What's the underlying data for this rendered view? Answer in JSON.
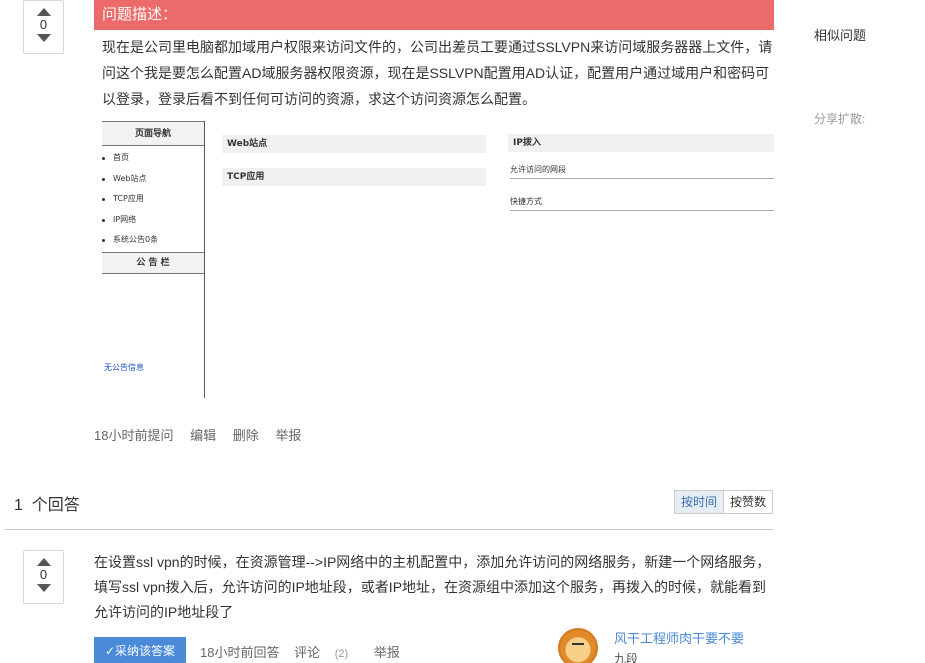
{
  "question": {
    "votes": "0",
    "header": "问题描述：",
    "body": "现在是公司里电脑都加域用户权限来访问文件的，公司出差员工要通过SSLVPN来访问域服务器器上文件，请问这个我是要怎么配置AD域服务器权限资源，现在是SSLVPN配置用AD认证，配置用户通过域用户和密码可以登录，登录后看不到任何可访问的资源，求这个访问资源怎么配置。",
    "meta": {
      "time": "18小时前提问",
      "edit": "编辑",
      "delete": "删除",
      "report": "举报"
    }
  },
  "screenshot": {
    "nav_title": "页面导航",
    "nav_items": [
      "首页",
      "Web站点",
      "TCP应用",
      "IP网络",
      "系统公告0条"
    ],
    "board_title": "公 告 栏",
    "notice": "无公告信息",
    "web_panel": "Web站点",
    "tcp_panel": "TCP应用",
    "ip_panel": "IP拨入",
    "allowed_segment": "允许访问的网段",
    "shortcut": "快捷方式"
  },
  "answers": {
    "count": "1",
    "count_label": "个回答",
    "sort": {
      "by_time": "按时间",
      "by_votes": "按赞数"
    }
  },
  "answer": {
    "votes": "0",
    "body": "在设置ssl vpn的时候，在资源管理-->IP网络中的主机配置中，添加允许访问的网络服务，新建一个网络服务，填写ssl vpn拨入后，允许访问的IP地址段，或者IP地址，在资源组中添加这个服务，再拨入的时候，就能看到允许访问的IP地址段了",
    "accept": "✓采纳该答案",
    "time": "18小时前回答",
    "comment": "评论",
    "comment_count": "(2)",
    "report": "举报",
    "username": "风干工程师肉干要不要",
    "rank": "九段"
  },
  "sidebar": {
    "similar": "相似问题",
    "share": "分享扩散:"
  },
  "colors": {
    "header_bg": "#ec6a6a",
    "accent": "#4a8ad8",
    "link": "#1a4fd1"
  }
}
